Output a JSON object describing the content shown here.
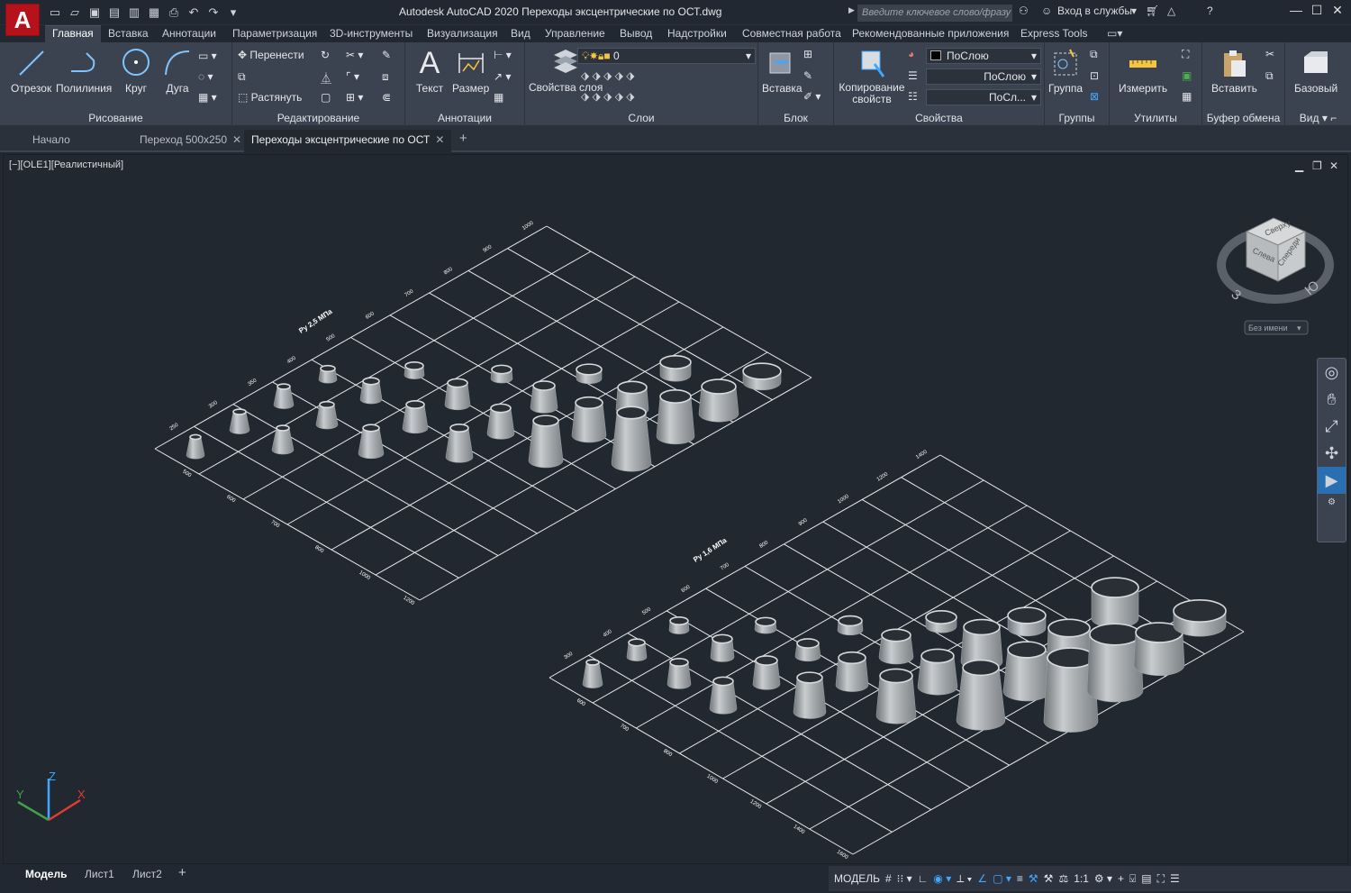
{
  "titlebar": {
    "app_logo": "A",
    "title": "Autodesk AutoCAD 2020   Переходы эксцентрические по ОСТ.dwg",
    "search_placeholder": "Введите ключевое слово/фразу",
    "signin": "Вход в службы"
  },
  "ribbon_tabs": [
    "Главная",
    "Вставка",
    "Аннотации",
    "Параметризация",
    "3D-инструменты",
    "Визуализация",
    "Вид",
    "Управление",
    "Вывод",
    "Надстройки",
    "Совместная работа",
    "Рекомендованные приложения",
    "Express Tools"
  ],
  "ribbon": {
    "draw": {
      "label": "Рисование",
      "line": "Отрезок",
      "polyline": "Полилиния",
      "circle": "Круг",
      "arc": "Дуга"
    },
    "modify": {
      "label": "Редактирование",
      "move": "Перенести",
      "stretch": "Растянуть"
    },
    "annotation": {
      "label": "Аннотации",
      "text": "Текст",
      "dimension": "Размер"
    },
    "layers": {
      "label": "Слои",
      "layer_props": "Свойства слоя",
      "layer_value": "0"
    },
    "block": {
      "label": "Блок",
      "insert": "Вставка"
    },
    "properties": {
      "label": "Свойства",
      "match": "Копирование свойств",
      "color": "ПоСлою",
      "linetype": "ПоСлою",
      "lineweight": "ПоСл..."
    },
    "groups": {
      "label": "Группы",
      "group": "Группа"
    },
    "utilities": {
      "label": "Утилиты",
      "measure": "Измерить"
    },
    "clipboard": {
      "label": "Буфер обмена",
      "paste": "Вставить"
    },
    "view": {
      "label": "Вид",
      "base": "Базовый"
    }
  },
  "doc_tabs": {
    "start": "Начало",
    "tab1": "Переход 500х250",
    "tab2": "Переходы эксцентрические по ОСТ",
    "plus": "+"
  },
  "viewport": {
    "label": "[−][OLE1][Реалистичный]",
    "viewcube_top": "Сверху",
    "viewcube_left": "Слева",
    "viewcube_front": "Спереди",
    "ucs_name": "Без имени",
    "grid1_title": "Ру 2,5 МПа",
    "grid2_title": "Ру 1,6 МПа",
    "grid1_top_labels": [
      "250",
      "300",
      "350",
      "400",
      "500",
      "600",
      "700",
      "800",
      "900",
      "1000"
    ],
    "grid1_side_labels": [
      "500",
      "600",
      "700",
      "800",
      "1000",
      "1200"
    ],
    "grid2_top_labels": [
      "300",
      "400",
      "500",
      "600",
      "700",
      "800",
      "900",
      "1000",
      "1200",
      "1400"
    ],
    "grid2_side_labels": [
      "600",
      "700",
      "800",
      "1000",
      "1200",
      "1400",
      "1600"
    ]
  },
  "statusbar": {
    "tabs": [
      "Модель",
      "Лист1",
      "Лист2"
    ],
    "plus": "+",
    "model": "МОДЕЛЬ",
    "scale": "1:1"
  },
  "colors": {
    "background": "#212830",
    "ribbon": "#3b4350",
    "logo": "#b5121b",
    "accent": "#3fa7ff"
  }
}
